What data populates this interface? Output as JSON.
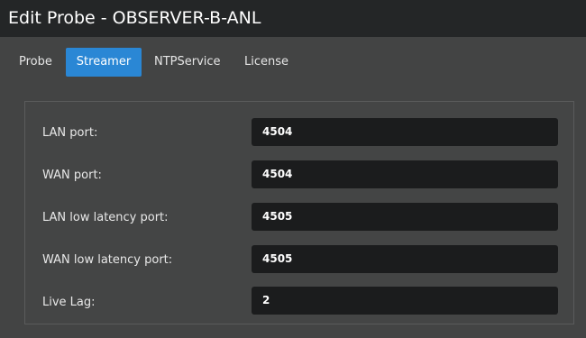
{
  "window": {
    "title": "Edit Probe - OBSERVER-B-ANL"
  },
  "tabs": [
    {
      "label": "Probe",
      "active": false
    },
    {
      "label": "Streamer",
      "active": true
    },
    {
      "label": "NTPService",
      "active": false
    },
    {
      "label": "License",
      "active": false
    }
  ],
  "streamer": {
    "fields": [
      {
        "label": "LAN port:",
        "value": "4504"
      },
      {
        "label": "WAN port:",
        "value": "4504"
      },
      {
        "label": "LAN low latency port:",
        "value": "4505"
      },
      {
        "label": "WAN low latency port:",
        "value": "4505"
      },
      {
        "label": "Live Lag:",
        "value": "2"
      }
    ]
  },
  "colors": {
    "titlebar": "#242627",
    "background": "#434444",
    "active_tab": "#2a87d5",
    "field": "#1b1c1d"
  }
}
